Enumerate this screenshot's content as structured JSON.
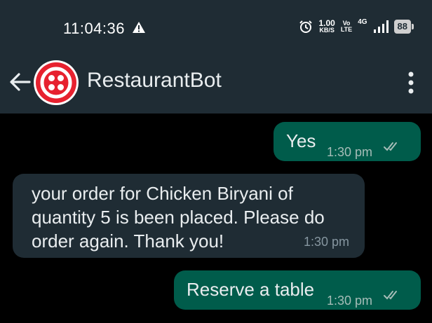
{
  "status_bar": {
    "time": "11:04:36",
    "speed_value": "1.00",
    "speed_unit": "KB/S",
    "volte_top": "Vo",
    "volte_bottom": "LTE",
    "network": "4G",
    "battery": "88",
    "icons": [
      "warning-icon",
      "alarm-icon",
      "signal-icon",
      "battery-icon"
    ]
  },
  "header": {
    "title": "RestaurantBot",
    "back_icon": "arrow-left-icon",
    "menu_icon": "more-vert-icon",
    "avatar_color": "#e7212f"
  },
  "messages": [
    {
      "direction": "out",
      "text": "Yes",
      "time": "1:30 pm",
      "status": "read"
    },
    {
      "direction": "in",
      "lines": [
        "your order for Chicken Biryani of",
        "quantity 5 is been placed. Please do",
        "order again. Thank you!"
      ],
      "time": "1:30 pm"
    },
    {
      "direction": "out",
      "text": "Reserve a table",
      "time": "1:30 pm",
      "status": "read"
    }
  ],
  "colors": {
    "background": "#000000",
    "bar": "#1f2c34",
    "outgoing": "#005c4b",
    "incoming": "#1f2c34"
  }
}
